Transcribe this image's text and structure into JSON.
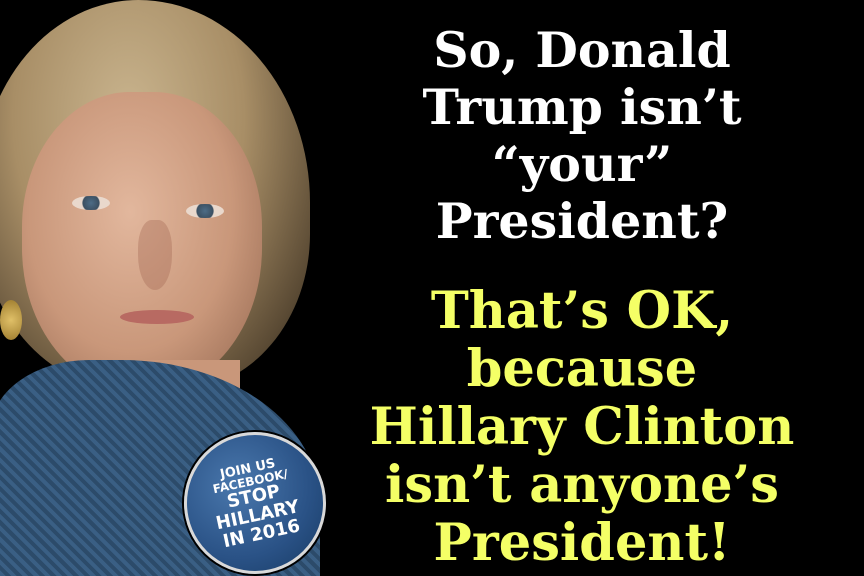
{
  "headline_white": {
    "line1": "So, Donald",
    "line2": "Trump isn’t",
    "line3": "“your”",
    "line4": "President?"
  },
  "headline_yellow": {
    "line1": "That’s OK,",
    "line2": "because",
    "line3": "Hillary Clinton",
    "line4": "isn’t anyone’s",
    "line5": "President!"
  },
  "badge": {
    "line1": "JOIN US",
    "line2": "FACEBOOK/",
    "line3": "STOP",
    "line4": "HILLARY",
    "line5": "IN 2016"
  },
  "colors": {
    "background": "#000000",
    "white_text": "#ffffff",
    "yellow_text": "#f4ff66",
    "badge": "#2a5286"
  }
}
